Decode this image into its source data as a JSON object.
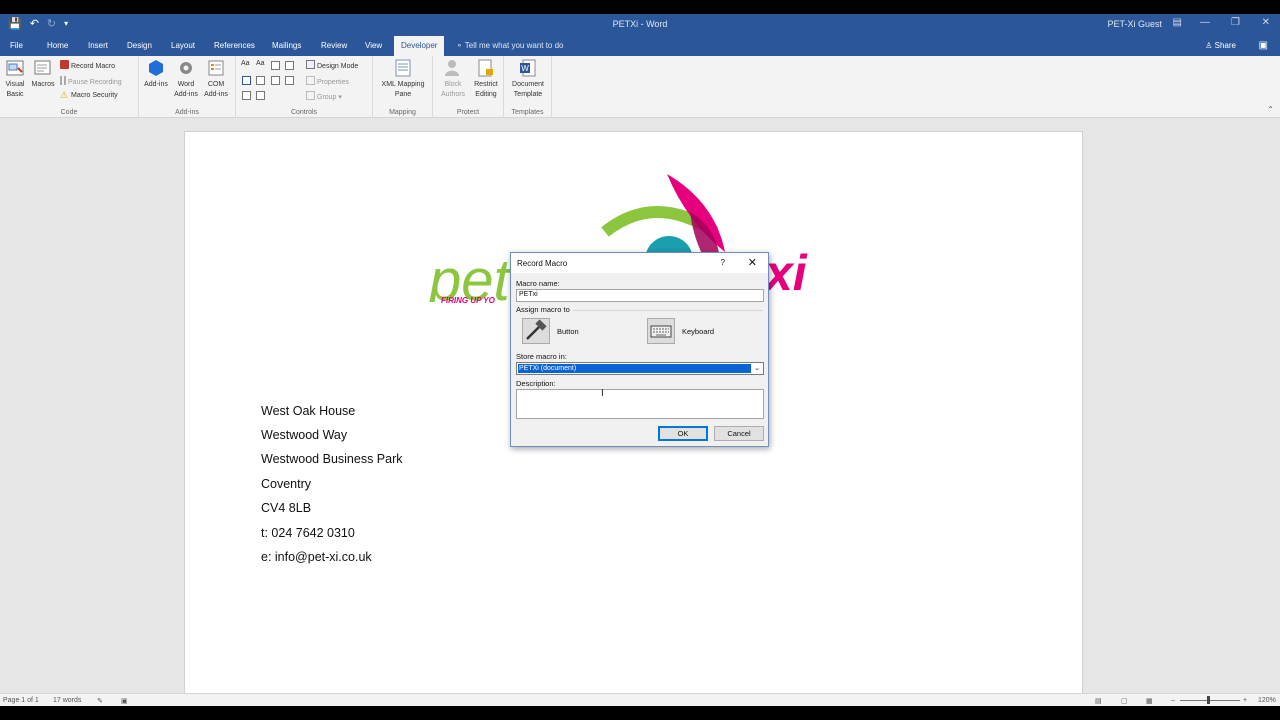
{
  "window": {
    "title": "PETXi  -  Word",
    "user": "PET-Xi Guest",
    "title_bar_color": "#2b579a"
  },
  "tabs": [
    "File",
    "Home",
    "Insert",
    "Design",
    "Layout",
    "References",
    "Mailings",
    "Review",
    "View",
    "Developer"
  ],
  "active_tab": "Developer",
  "tell_me": "Tell me what you want to do",
  "share": "Share",
  "ribbon": {
    "code": {
      "label": "Code",
      "visual_basic": "Visual Basic",
      "macros": "Macros",
      "record_macro": "Record Macro",
      "pause_recording": "Pause Recording",
      "macro_security": "Macro Security"
    },
    "addins": {
      "label": "Add-ins",
      "addins": "Add-ins",
      "word_addins": "Word Add-ins",
      "com_addins": "COM Add-ins"
    },
    "controls": {
      "label": "Controls",
      "design_mode": "Design Mode",
      "properties": "Properties",
      "group": "Group"
    },
    "mapping": {
      "label": "Mapping",
      "xml_mapping_pane": "XML Mapping Pane"
    },
    "protect": {
      "label": "Protect",
      "block_authors": "Block Authors",
      "restrict_editing": "Restrict Editing"
    },
    "templates": {
      "label": "Templates",
      "document_template": "Document Template"
    }
  },
  "document": {
    "logo_text": "FIRING UP YO",
    "address_lines": [
      "West Oak House",
      "Westwood Way",
      "Westwood Business Park",
      "Coventry",
      "CV4 8LB",
      "t: 024 7642 0310",
      "e: info@pet-xi.co.uk"
    ]
  },
  "dialog": {
    "title": "Record Macro",
    "help": "?",
    "close": "✕",
    "macro_name_label": "Macro name:",
    "macro_name_value": "PETxi",
    "assign_label": "Assign macro to",
    "button_label": "Button",
    "keyboard_label": "Keyboard",
    "store_label": "Store macro in:",
    "store_value": "PETXi (document)",
    "description_label": "Description:",
    "description_value": "",
    "ok": "OK",
    "cancel": "Cancel"
  },
  "status": {
    "page": "Page 1 of 1",
    "words": "17 words",
    "zoom": "120%"
  },
  "colors": {
    "logo_green": "#8cc63f",
    "logo_pink": "#e6007e",
    "logo_teal": "#1a9fb0",
    "selection_blue": "#0a64d6"
  }
}
